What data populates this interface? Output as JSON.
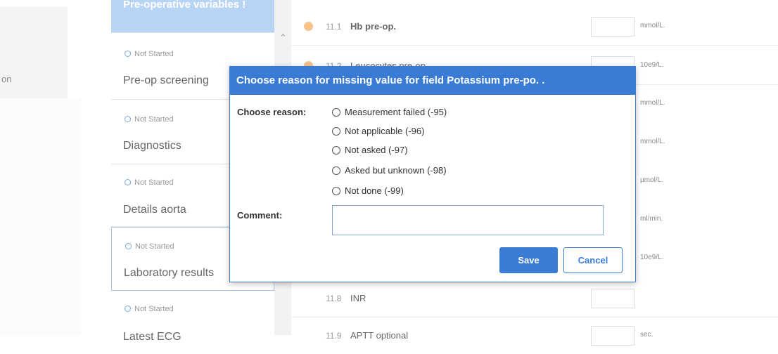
{
  "left": {
    "label": "on"
  },
  "steps": [
    {
      "status": "",
      "title": "Pre-operative variables",
      "badge": "!"
    },
    {
      "status": "Not Started",
      "title": "Pre-op screening"
    },
    {
      "status": "Not Started",
      "title": "Diagnostics"
    },
    {
      "status": "Not Started",
      "title": "Details aorta"
    },
    {
      "status": "Not Started",
      "title": "Laboratory results"
    },
    {
      "status": "Not Started",
      "title": "Latest ECG"
    }
  ],
  "fields": [
    {
      "num": "11.1",
      "label": "Hb pre-op.",
      "unit": "mmol/L."
    },
    {
      "num": "11.2",
      "label": "Leucocytes pre-op.",
      "unit": "10e9/L."
    },
    {
      "num": "11.8",
      "label": "INR",
      "unit": ""
    },
    {
      "num": "11.9",
      "label": "APTT optional",
      "unit": "sec."
    }
  ],
  "hidden_units": [
    "mmol/L.",
    "mmol/L.",
    "µmol/L.",
    "ml/min.",
    "10e9/L."
  ],
  "modal": {
    "title": "Choose reason for missing value for field Potassium pre-po. .",
    "reason_label": "Choose reason:",
    "options": [
      "Measurement failed (-95)",
      "Not applicable (-96)",
      "Not asked (-97)",
      "Asked but unknown (-98)",
      "Not done (-99)"
    ],
    "comment_label": "Comment:",
    "comment_value": "",
    "save_label": "Save",
    "cancel_label": "Cancel"
  },
  "colors": {
    "primary": "#3a7bd5",
    "active_step": "#b8d4f5",
    "bullet": "#f7c38d"
  }
}
